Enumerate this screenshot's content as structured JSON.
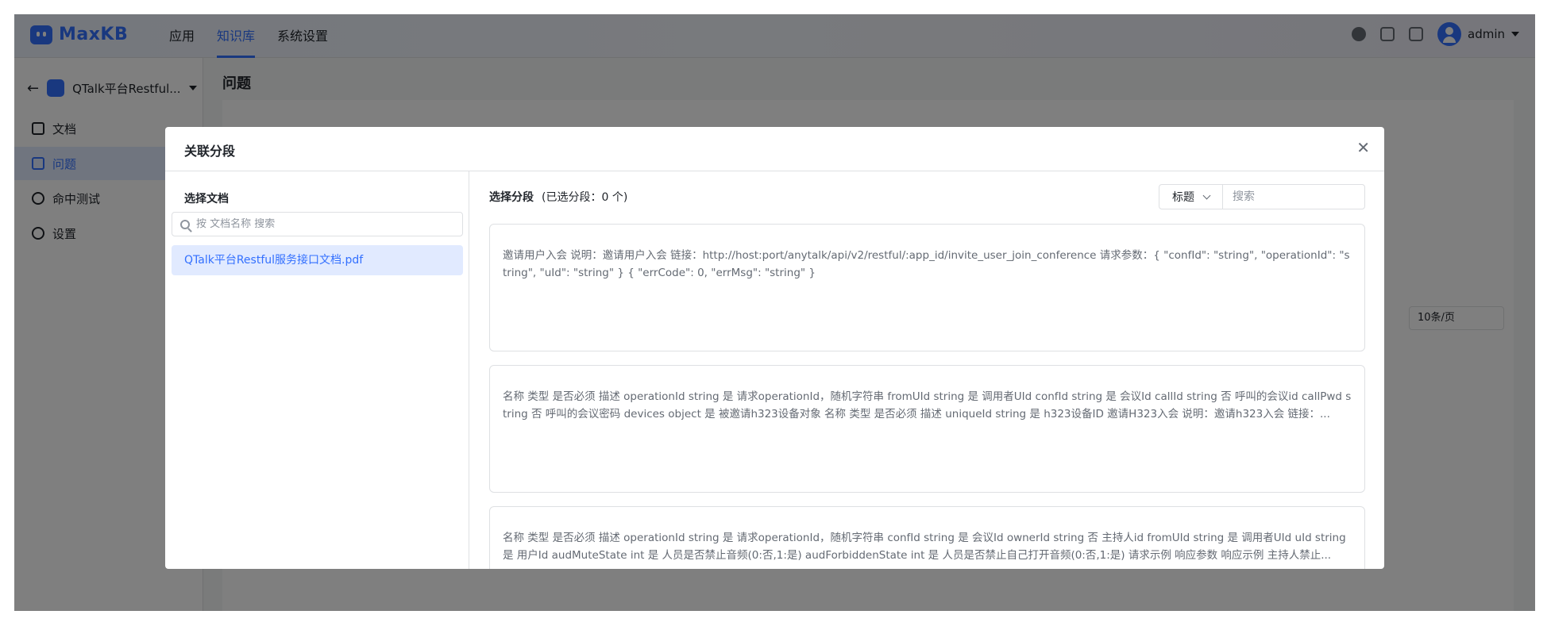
{
  "app": {
    "logo_text": "MaxKB"
  },
  "nav": {
    "items": [
      "应用",
      "知识库",
      "系统设置"
    ],
    "active_index": 1
  },
  "user": {
    "name": "admin"
  },
  "sidebar": {
    "kb_name": "QTalk平台Restful...",
    "items": [
      {
        "label": "文档",
        "icon": "document-icon"
      },
      {
        "label": "问题",
        "icon": "question-icon",
        "active": true
      },
      {
        "label": "命中测试",
        "icon": "target-icon"
      },
      {
        "label": "设置",
        "icon": "gear-icon"
      }
    ]
  },
  "page": {
    "title": "问题",
    "pagination": "10条/页"
  },
  "dialog": {
    "title": "关联分段",
    "left": {
      "label": "选择文档",
      "search_placeholder": "按 文档名称 搜索",
      "documents": [
        "QTalk平台Restful服务接口文档.pdf"
      ]
    },
    "right": {
      "label": "选择分段",
      "selected_count": "(已选分段：0 个)",
      "filter_select": "标题",
      "search_placeholder": "搜索",
      "segments": [
        "邀请用户入会 说明：邀请用户入会 链接：http://host:port/anytalk/api/v2/restful/:app_id/invite_user_join_conference 请求参数：{ \"confId\": \"string\", \"operationId\": \"string\", \"uId\": \"string\" } { \"errCode\": 0, \"errMsg\": \"string\" }",
        "名称 类型 是否必须 描述 operationId string 是 请求operationId，随机字符串 fromUId string 是 调用者UId confId string 是 会议Id callId string 否 呼叫的会议id callPwd string 否 呼叫的会议密码 devices object 是 被邀请h323设备对象 名称 类型 是否必须 描述 uniqueId string 是 h323设备ID   邀请H323入会 说明：邀请h323入会 链接：...",
        "名称 类型 是否必须 描述 operationId string 是 请求operationId，随机字符串 confId string 是 会议Id ownerId string 否 主持人id fromUId string 是 调用者UId uId string 是 用户Id audMuteState int 是 人员是否禁止音频(0:否,1:是) audForbiddenState int 是 人员是否禁止自己打开音频(0:否,1:是) 请求示例 响应参数 响应示例   主持人禁止..."
      ]
    }
  }
}
